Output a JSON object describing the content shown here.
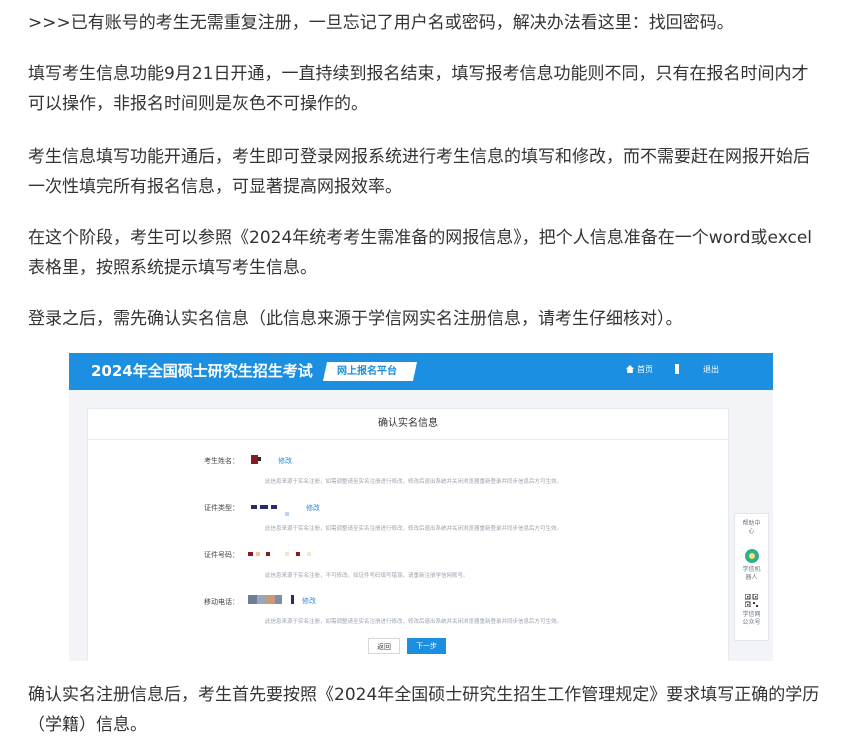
{
  "article": {
    "paragraphs": [
      ">>>已有账号的考生无需重复注册，一旦忘记了用户名或密码，解决办法看这里：找回密码。",
      "填写考生信息功能9月21日开通，一直持续到报名结束，填写报考信息功能则不同，只有在报名时间内才可以操作，非报名时间则是灰色不可操作的。",
      "考生信息填写功能开通后，考生即可登录网报系统进行考生信息的填写和修改，而不需要赶在网报开始后一次性填完所有报名信息，可显著提高网报效率。",
      "在这个阶段，考生可以参照《2024年统考考生需准备的网报信息》，把个人信息准备在一个word或excel表格里，按照系统提示填写考生信息。",
      "登录之后，需先确认实名信息（此信息来源于学信网实名注册信息，请考生仔细核对）。",
      "确认实名注册信息后，考生首先要按照《2024年全国硕士研究生招生工作管理规定》要求填写正确的学历（学籍）信息。"
    ]
  },
  "screenshot": {
    "header": {
      "title": "2024年全国硕士研究生招生考试",
      "platform": "网上报名平台",
      "home": "首页",
      "logout": "退出"
    },
    "card_title": "确认实名信息",
    "rows": [
      {
        "label": "考生姓名：",
        "edit": "修改",
        "note": "此信息来源于实名注册，如需调整请至实名注册进行修改，修改后退出系统并关闭浏览器重新登录并同步信息后方可生效。"
      },
      {
        "label": "证件类型：",
        "edit": "修改",
        "note": "此信息来源于实名注册，如需调整请至实名注册进行修改，修改后退出系统并关闭浏览器重新登录并同步信息后方可生效。"
      },
      {
        "label": "证件号码：",
        "edit": "",
        "note": "此信息来源于实名注册，不可修改。如证件号码填写错误，请重新注册学信网账号。"
      },
      {
        "label": "移动电话：",
        "edit": "修改",
        "note": "此信息来源于实名注册，如需调整请至实名注册进行修改，修改后退出系统并关闭浏览器重新登录并同步信息后方可生效。"
      }
    ],
    "buttons": {
      "back": "返回",
      "next": "下一步"
    },
    "side": {
      "help": "帮助中心",
      "robot": "学信机器人",
      "qr": "学信网公众号"
    }
  },
  "colors": {
    "brand_blue": "#1c8fe0",
    "link_blue": "#2a8ae2",
    "body_text": "#333333",
    "note_gray": "#9aa3ad"
  },
  "icons": [
    "home-icon",
    "robot-icon",
    "qr-code-icon"
  ]
}
